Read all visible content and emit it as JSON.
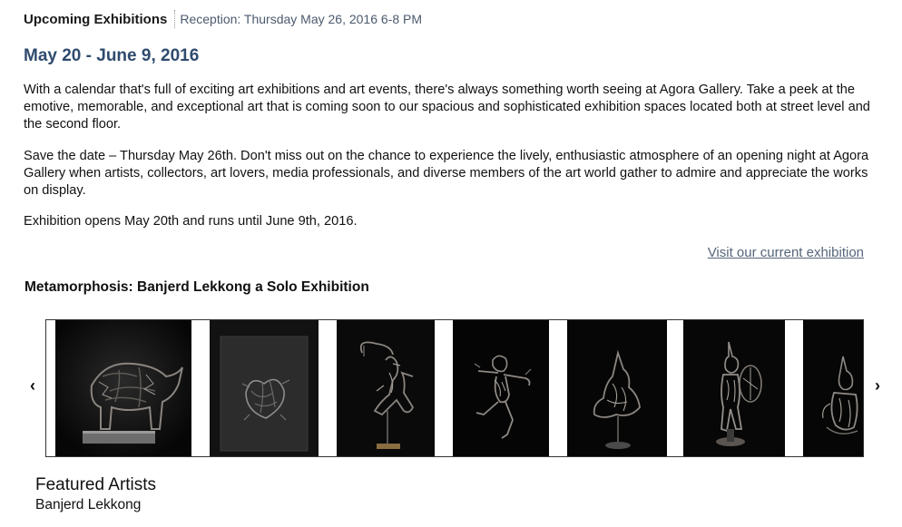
{
  "header": {
    "section_title": "Upcoming Exhibitions",
    "reception": "Reception: Thursday May 26, 2016 6-8 PM"
  },
  "date_range": "May 20 - June 9, 2016",
  "paragraphs": [
    "With a calendar that's full of exciting art exhibitions and art events, there's always something worth seeing at Agora Gallery. Take a peek at the emotive, memorable, and exceptional art that is coming soon to our spacious and sophisticated exhibition spaces located both at street level and the second floor.",
    "Save the date – Thursday May 26th. Don't miss out on the chance to experience the lively, enthusiastic atmosphere of an opening night at Agora Gallery when artists, collectors, art lovers, media professionals, and diverse members of the art world gather to admire and appreciate the works on display.",
    "Exhibition opens May 20th and runs until June 9th, 2016."
  ],
  "visit_link": "Visit our current exhibition",
  "exhibition_title": "Metamorphosis: Banjerd Lekkong a Solo Exhibition",
  "carousel": {
    "prev_glyph": "‹",
    "next_glyph": "›",
    "prev_icon": "chevron-left-icon",
    "next_icon": "chevron-right-icon",
    "images": [
      {
        "name": "rhino-sculpture"
      },
      {
        "name": "mask-relief-sculpture"
      },
      {
        "name": "archer-figure-sculpture"
      },
      {
        "name": "dancing-figure-sculpture"
      },
      {
        "name": "headdress-sculpture"
      },
      {
        "name": "warrior-shield-sculpture"
      },
      {
        "name": "crowned-figure-sculpture"
      }
    ]
  },
  "featured": {
    "heading": "Featured Artists",
    "artists": [
      "Banjerd Lekkong"
    ]
  },
  "colors": {
    "heading_blue": "#2f4b6e",
    "link_gray": "#56657a",
    "reception_gray": "#4b5a6e",
    "photo_background": "#0a0a0a",
    "sculpture_metal": "#8a8580"
  }
}
